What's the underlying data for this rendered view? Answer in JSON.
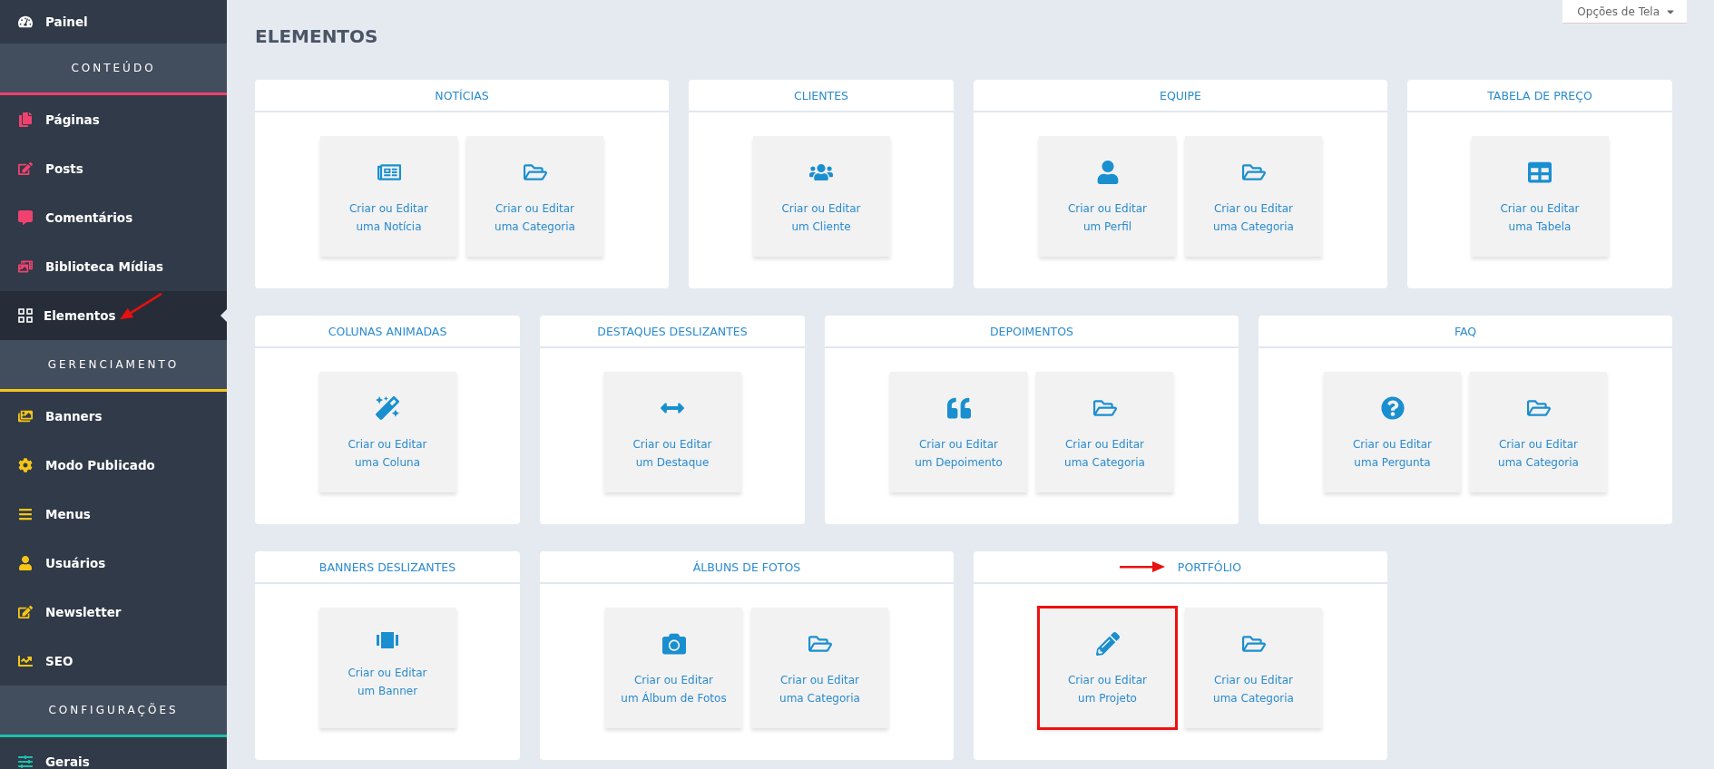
{
  "sidebar": {
    "top_item": {
      "label": "Painel",
      "kind": "dashboard"
    },
    "sections": [
      {
        "title": "CONTEÚDO",
        "color": "#f0426f",
        "items": [
          {
            "label": "Páginas",
            "kind": "pages",
            "selected": false,
            "annotation_arrow": false
          },
          {
            "label": "Posts",
            "kind": "edit",
            "selected": false,
            "annotation_arrow": false
          },
          {
            "label": "Comentários",
            "kind": "comment",
            "selected": false,
            "annotation_arrow": false
          },
          {
            "label": "Biblioteca Mídias",
            "kind": "media",
            "selected": false,
            "annotation_arrow": false
          },
          {
            "label": "Elementos",
            "kind": "grid",
            "selected": true,
            "annotation_arrow": true
          }
        ]
      },
      {
        "title": "GERENCIAMENTO",
        "color": "#f5c518",
        "items": [
          {
            "label": "Banners",
            "kind": "images",
            "selected": false,
            "annotation_arrow": false
          },
          {
            "label": "Modo Publicado",
            "kind": "gear",
            "selected": false,
            "annotation_arrow": false
          },
          {
            "label": "Menus",
            "kind": "bars",
            "selected": false,
            "annotation_arrow": false
          },
          {
            "label": "Usuários",
            "kind": "user",
            "selected": false,
            "annotation_arrow": false
          },
          {
            "label": "Newsletter",
            "kind": "edit",
            "selected": false,
            "annotation_arrow": false
          },
          {
            "label": "SEO",
            "kind": "chart",
            "selected": false,
            "annotation_arrow": false
          }
        ]
      },
      {
        "title": "CONFIGURAÇÕES",
        "color": "#1fbfad",
        "items": [
          {
            "label": "Gerais",
            "kind": "sliders",
            "selected": false,
            "annotation_arrow": false
          }
        ]
      }
    ]
  },
  "screen_options": {
    "label": "Opções de Tela"
  },
  "page_title": "ELEMENTOS",
  "rows": [
    [
      {
        "title": "NOTÍCIAS",
        "annotation_arrow": false,
        "tiles": [
          {
            "kind": "news",
            "line1": "Criar ou Editar",
            "line2": "uma Notícia",
            "highlighted": false
          },
          {
            "kind": "folder",
            "line1": "Criar ou Editar",
            "line2": "uma Categoria",
            "highlighted": false
          }
        ]
      },
      {
        "title": "CLIENTES",
        "annotation_arrow": false,
        "tiles": [
          {
            "kind": "users",
            "line1": "Criar ou Editar",
            "line2": "um Cliente",
            "highlighted": false
          }
        ]
      },
      {
        "title": "EQUIPE",
        "annotation_arrow": false,
        "tiles": [
          {
            "kind": "user",
            "line1": "Criar ou Editar",
            "line2": "um Perfil",
            "highlighted": false
          },
          {
            "kind": "folder",
            "line1": "Criar ou Editar",
            "line2": "uma Categoria",
            "highlighted": false
          }
        ]
      },
      {
        "title": "TABELA DE PREÇO",
        "annotation_arrow": false,
        "tiles": [
          {
            "kind": "table",
            "line1": "Criar ou Editar",
            "line2": "uma Tabela",
            "highlighted": false
          }
        ]
      }
    ],
    [
      {
        "title": "COLUNAS ANIMADAS",
        "annotation_arrow": false,
        "tiles": [
          {
            "kind": "magic",
            "line1": "Criar ou Editar",
            "line2": "uma Coluna",
            "highlighted": false
          }
        ]
      },
      {
        "title": "DESTAQUES DESLIZANTES",
        "annotation_arrow": false,
        "tiles": [
          {
            "kind": "arrows",
            "line1": "Criar ou Editar",
            "line2": "um Destaque",
            "highlighted": false
          }
        ]
      },
      {
        "title": "DEPOIMENTOS",
        "annotation_arrow": false,
        "tiles": [
          {
            "kind": "quote",
            "line1": "Criar ou Editar",
            "line2": "um Depoimento",
            "highlighted": false
          },
          {
            "kind": "folder",
            "line1": "Criar ou Editar",
            "line2": "uma Categoria",
            "highlighted": false
          }
        ]
      },
      {
        "title": "FAQ",
        "annotation_arrow": false,
        "tiles": [
          {
            "kind": "question",
            "line1": "Criar ou Editar",
            "line2": "uma Pergunta",
            "highlighted": false
          },
          {
            "kind": "folder",
            "line1": "Criar ou Editar",
            "line2": "uma Categoria",
            "highlighted": false
          }
        ]
      }
    ],
    [
      {
        "title": "BANNERS DESLIZANTES",
        "annotation_arrow": false,
        "tiles": [
          {
            "kind": "slider",
            "line1": "Criar ou Editar",
            "line2": "um Banner",
            "highlighted": false
          }
        ]
      },
      {
        "title": "ÁLBUNS DE FOTOS",
        "annotation_arrow": false,
        "tiles": [
          {
            "kind": "camera",
            "line1": "Criar ou Editar",
            "line2": "um Álbum de Fotos",
            "highlighted": false
          },
          {
            "kind": "folder",
            "line1": "Criar ou Editar",
            "line2": "uma Categoria",
            "highlighted": false
          }
        ]
      },
      {
        "title": "PORTFÓLIO",
        "annotation_arrow": true,
        "tiles": [
          {
            "kind": "pencil",
            "line1": "Criar ou Editar",
            "line2": "um Projeto",
            "highlighted": true
          },
          {
            "kind": "folder",
            "line1": "Criar ou Editar",
            "line2": "uma Categoria",
            "highlighted": false
          }
        ]
      }
    ]
  ]
}
